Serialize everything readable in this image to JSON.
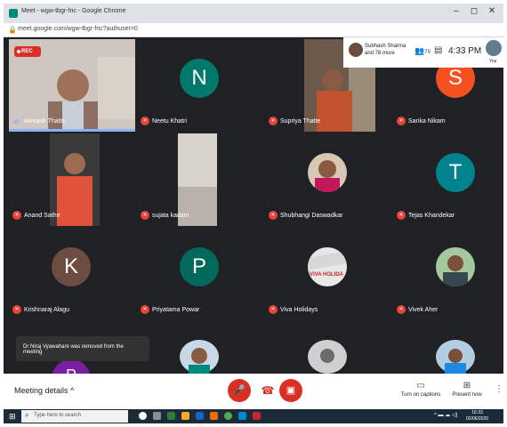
{
  "browser": {
    "tab_title": "Meet - wgw-tbgr-fnc - Google Chrome",
    "url": "meet.google.com/wgw-tbgr-fnc?authuser=0",
    "window_controls": [
      "–",
      "◻",
      "✕"
    ]
  },
  "meeting": {
    "recording_label": "REC",
    "top_panel": {
      "presenter_text": "Subhash Sharma and 78 more",
      "participant_count": "79",
      "time": "4:33 PM",
      "you_label": "You"
    },
    "participants": [
      {
        "name": "Avinash Thatte",
        "type": "video",
        "active": true
      },
      {
        "name": "Neetu Khatri",
        "type": "initial",
        "initial": "N",
        "color": "#00796b"
      },
      {
        "name": "Supriya Thatte",
        "type": "video"
      },
      {
        "name": "Sarika Nikam",
        "type": "initial",
        "initial": "S",
        "color": "#f4511e"
      },
      {
        "name": "Anand Sathe",
        "type": "video"
      },
      {
        "name": "sujata kadam",
        "type": "video"
      },
      {
        "name": "Shubhangi Daswadkar",
        "type": "photo"
      },
      {
        "name": "Tejas Khandekar",
        "type": "initial",
        "initial": "T",
        "color": "#00838f"
      },
      {
        "name": "Krishnaraj Alagu",
        "type": "initial",
        "initial": "K",
        "color": "#6d4c41"
      },
      {
        "name": "Priyatama Powar",
        "type": "initial",
        "initial": "P",
        "color": "#00695c"
      },
      {
        "name": "Viva Holidays",
        "type": "photo",
        "logo_text": "VIVA HOLIDA"
      },
      {
        "name": "Vivek Aher",
        "type": "photo"
      }
    ],
    "toast": "Dr Niraj Vyawahare was removed from the meeting",
    "partial_initial": "P"
  },
  "bottom_bar": {
    "details_label": "Meeting details",
    "captions_label": "Turn on captions",
    "present_label": "Present now"
  },
  "taskbar": {
    "search_placeholder": "Type here to search",
    "clock_time": "16:33",
    "clock_date": "02/06/2020"
  }
}
